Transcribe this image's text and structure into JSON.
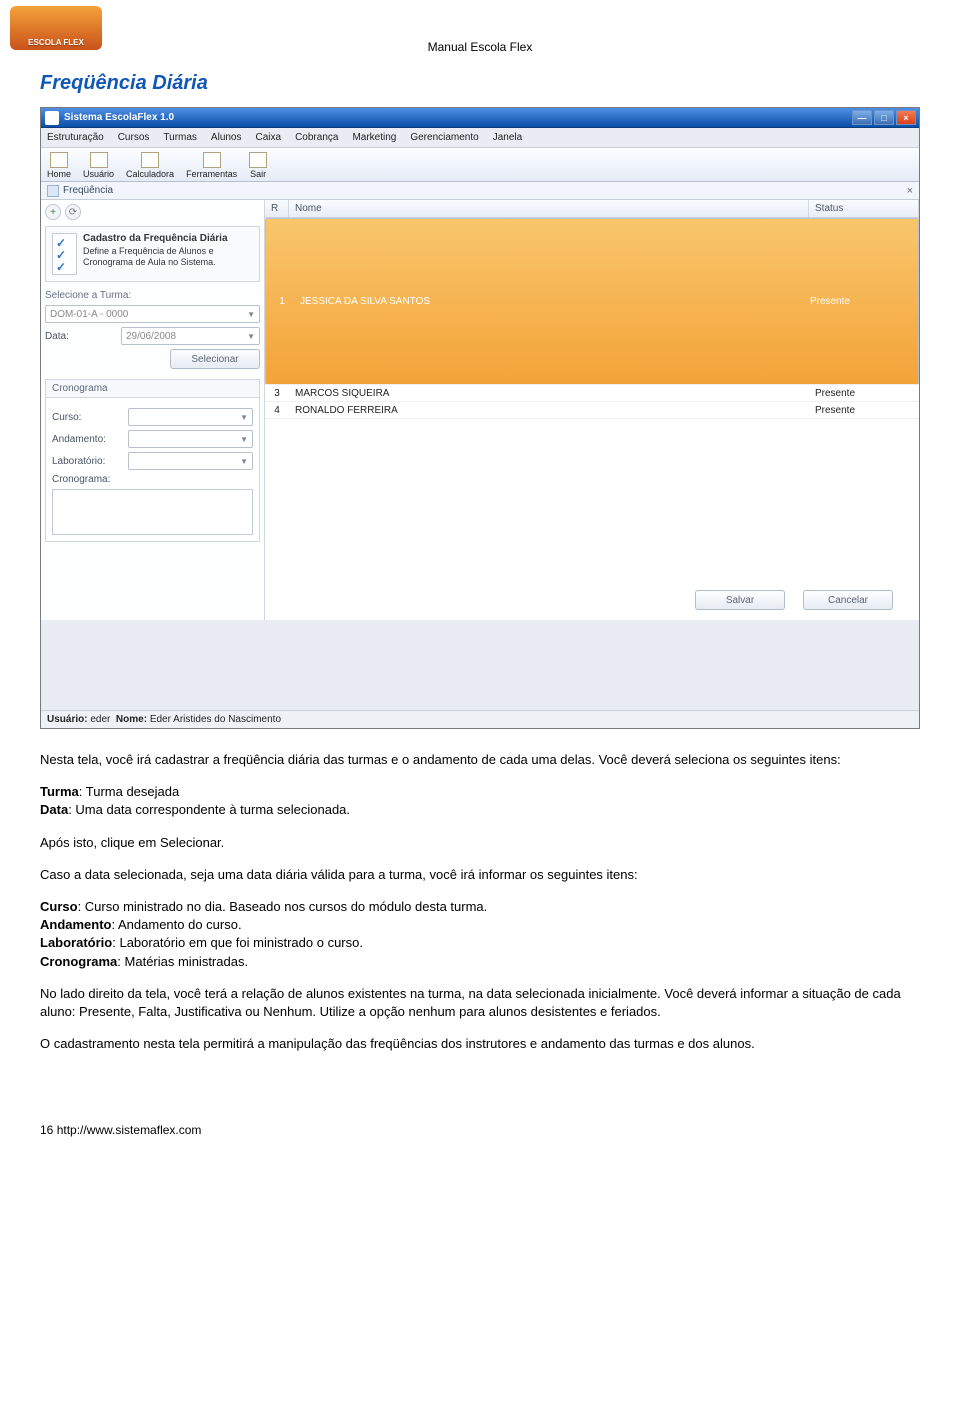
{
  "doc": {
    "logo_text": "ESCOLA FLEX",
    "header": "Manual Escola Flex",
    "section_title": "Freqüência Diária",
    "footer_page": "16",
    "footer_url": "http://www.sistemaflex.com"
  },
  "win": {
    "title": "Sistema EscolaFlex 1.0",
    "menus": [
      "Estruturação",
      "Cursos",
      "Turmas",
      "Alunos",
      "Caixa",
      "Cobrança",
      "Marketing",
      "Gerenciamento",
      "Janela"
    ],
    "toolbar": [
      "Home",
      "Usuário",
      "Calculadora",
      "Ferramentas",
      "Sair"
    ],
    "tab_label": "Freqüência",
    "close_glyph": "×",
    "min_glyph": "—",
    "max_glyph": "□",
    "xglyph": "×"
  },
  "side": {
    "card_title": "Cadastro da Frequência Diária",
    "card_desc": "Define a Frequência de Alunos e Cronograma de Aula no Sistema.",
    "label_turma": "Selecione a Turma:",
    "turma_value": "DOM-01-A - 0000",
    "label_data": "Data:",
    "data_value": "29/06/2008",
    "btn_selecionar": "Selecionar",
    "panel_cronograma": "Cronograma",
    "lbl_curso": "Curso:",
    "lbl_andamento": "Andamento:",
    "lbl_laboratorio": "Laboratório:",
    "lbl_cronograma": "Cronograma:"
  },
  "grid": {
    "col_r": "R",
    "col_nome": "Nome",
    "col_status": "Status",
    "rows": [
      {
        "r": "1",
        "nome": "JESSICA DA SILVA SANTOS",
        "status": "Presente"
      },
      {
        "r": "3",
        "nome": "MARCOS SIQUEIRA",
        "status": "Presente"
      },
      {
        "r": "4",
        "nome": "RONALDO FERREIRA",
        "status": "Presente"
      }
    ],
    "btn_salvar": "Salvar",
    "btn_cancelar": "Cancelar"
  },
  "status": {
    "usuario_lbl": "Usuário:",
    "usuario_val": "eder",
    "nome_lbl": "Nome:",
    "nome_val": "Eder Aristides do Nascimento"
  },
  "body": {
    "p1": "Nesta tela, você irá cadastrar a freqüência diária das turmas e o andamento de cada uma delas. Você deverá seleciona os seguintes itens:",
    "li_turma_b": "Turma",
    "li_turma": ": Turma desejada",
    "li_data_b": "Data",
    "li_data": ": Uma data correspondente à turma selecionada.",
    "p2": "Após isto, clique em Selecionar.",
    "p3": "Caso a data selecionada, seja uma data diária válida para a turma, você irá informar os seguintes itens:",
    "li_curso_b": "Curso",
    "li_curso": ": Curso ministrado no dia. Baseado nos cursos do módulo desta turma.",
    "li_and_b": "Andamento",
    "li_and": ": Andamento do curso.",
    "li_lab_b": "Laboratório",
    "li_lab": ": Laboratório em que foi ministrado o curso.",
    "li_cron_b": "Cronograma",
    "li_cron": ": Matérias ministradas.",
    "p4": "No lado direito da tela, você terá a relação de alunos existentes na turma, na data selecionada inicialmente. Você deverá informar a situação de cada aluno: Presente, Falta, Justificativa ou Nenhum. Utilize a opção nenhum para alunos desistentes e feriados.",
    "p5": "O cadastramento nesta tela permitirá a manipulação das freqüências dos instrutores e andamento das turmas e dos alunos."
  }
}
